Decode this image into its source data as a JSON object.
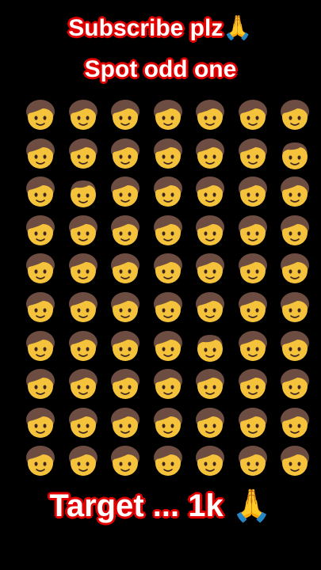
{
  "header": {
    "line1_text": "Subscribe plz",
    "line1_emoji": "🙏",
    "line2_text": "Spot odd one"
  },
  "footer": {
    "text": "Target ... 1k",
    "emoji": "🙏"
  },
  "puzzle": {
    "rows": 10,
    "cols": 7,
    "base_icon": "person-icon",
    "odd_icon": "boy-icon",
    "odd_cells": [
      {
        "row": 1,
        "col": 6
      },
      {
        "row": 2,
        "col": 1
      },
      {
        "row": 6,
        "col": 4
      }
    ]
  },
  "colors": {
    "background": "#000000",
    "text": "#ffffff",
    "outline": "#e00000",
    "face": "#f5c33b",
    "hair": "#6d4c41"
  }
}
